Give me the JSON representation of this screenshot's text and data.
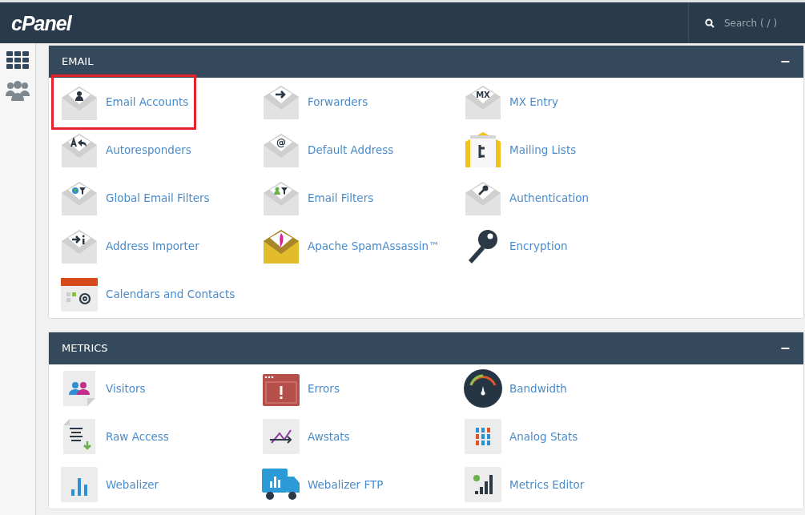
{
  "header": {
    "logo": "cPanel",
    "search": {
      "placeholder": "Search ( / )"
    }
  },
  "sections": [
    {
      "title": "EMAIL",
      "toggle": "−",
      "items": [
        {
          "label": "Email Accounts",
          "kind": "env-person",
          "highlighted": true
        },
        {
          "label": "Forwarders",
          "kind": "env-arrow",
          "highlighted": false
        },
        {
          "label": "MX Entry",
          "kind": "env-glyph",
          "glyph": "MX",
          "highlighted": false
        },
        {
          "label": "Autoresponders",
          "kind": "env-reply",
          "highlighted": false
        },
        {
          "label": "Default Address",
          "kind": "env-glyph",
          "glyph": "@",
          "highlighted": false
        },
        {
          "label": "Mailing Lists",
          "kind": "list-env",
          "highlighted": false
        },
        {
          "label": "Global Email Filters",
          "kind": "env-globe",
          "highlighted": false
        },
        {
          "label": "Email Filters",
          "kind": "env-filter",
          "highlighted": false
        },
        {
          "label": "Authentication",
          "kind": "env-key",
          "highlighted": false
        },
        {
          "label": "Address Importer",
          "kind": "env-import",
          "highlighted": false
        },
        {
          "label": "Apache SpamAssassin™",
          "kind": "env-feather",
          "highlighted": false
        },
        {
          "label": "Encryption",
          "kind": "key",
          "highlighted": false
        },
        {
          "label": "Calendars and Contacts",
          "kind": "calendar",
          "highlighted": false
        }
      ]
    },
    {
      "title": "METRICS",
      "toggle": "−",
      "items": [
        {
          "label": "Visitors",
          "kind": "visitors",
          "highlighted": false
        },
        {
          "label": "Errors",
          "kind": "errors",
          "highlighted": false
        },
        {
          "label": "Bandwidth",
          "kind": "gauge",
          "highlighted": false
        },
        {
          "label": "Raw Access",
          "kind": "raw",
          "highlighted": false
        },
        {
          "label": "Awstats",
          "kind": "trend",
          "highlighted": false
        },
        {
          "label": "Analog Stats",
          "kind": "digits",
          "highlighted": false
        },
        {
          "label": "Webalizer",
          "kind": "bars",
          "highlighted": false
        },
        {
          "label": "Webalizer FTP",
          "kind": "truck",
          "highlighted": false
        },
        {
          "label": "Metrics Editor",
          "kind": "signal",
          "highlighted": false
        }
      ]
    }
  ]
}
